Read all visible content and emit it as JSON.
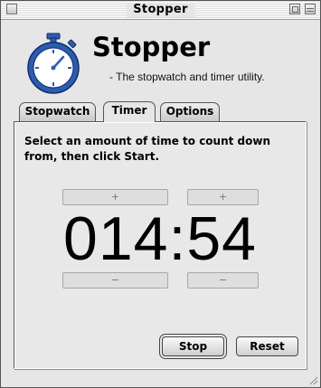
{
  "window": {
    "title": "Stopper"
  },
  "header": {
    "app_name": "Stopper",
    "tagline": "- The stopwatch and timer utility."
  },
  "tabs": [
    {
      "label": "Stopwatch",
      "active": false
    },
    {
      "label": "Timer",
      "active": true
    },
    {
      "label": "Options",
      "active": false
    }
  ],
  "timer": {
    "instructions": "Select an amount of time to count down from, then click Start.",
    "display": "014:54",
    "increment_label": "+",
    "decrement_label": "−"
  },
  "buttons": {
    "stop_label": "Stop",
    "reset_label": "Reset"
  },
  "icons": {
    "app_icon": "stopwatch-icon",
    "accent": "#2a5db0"
  }
}
